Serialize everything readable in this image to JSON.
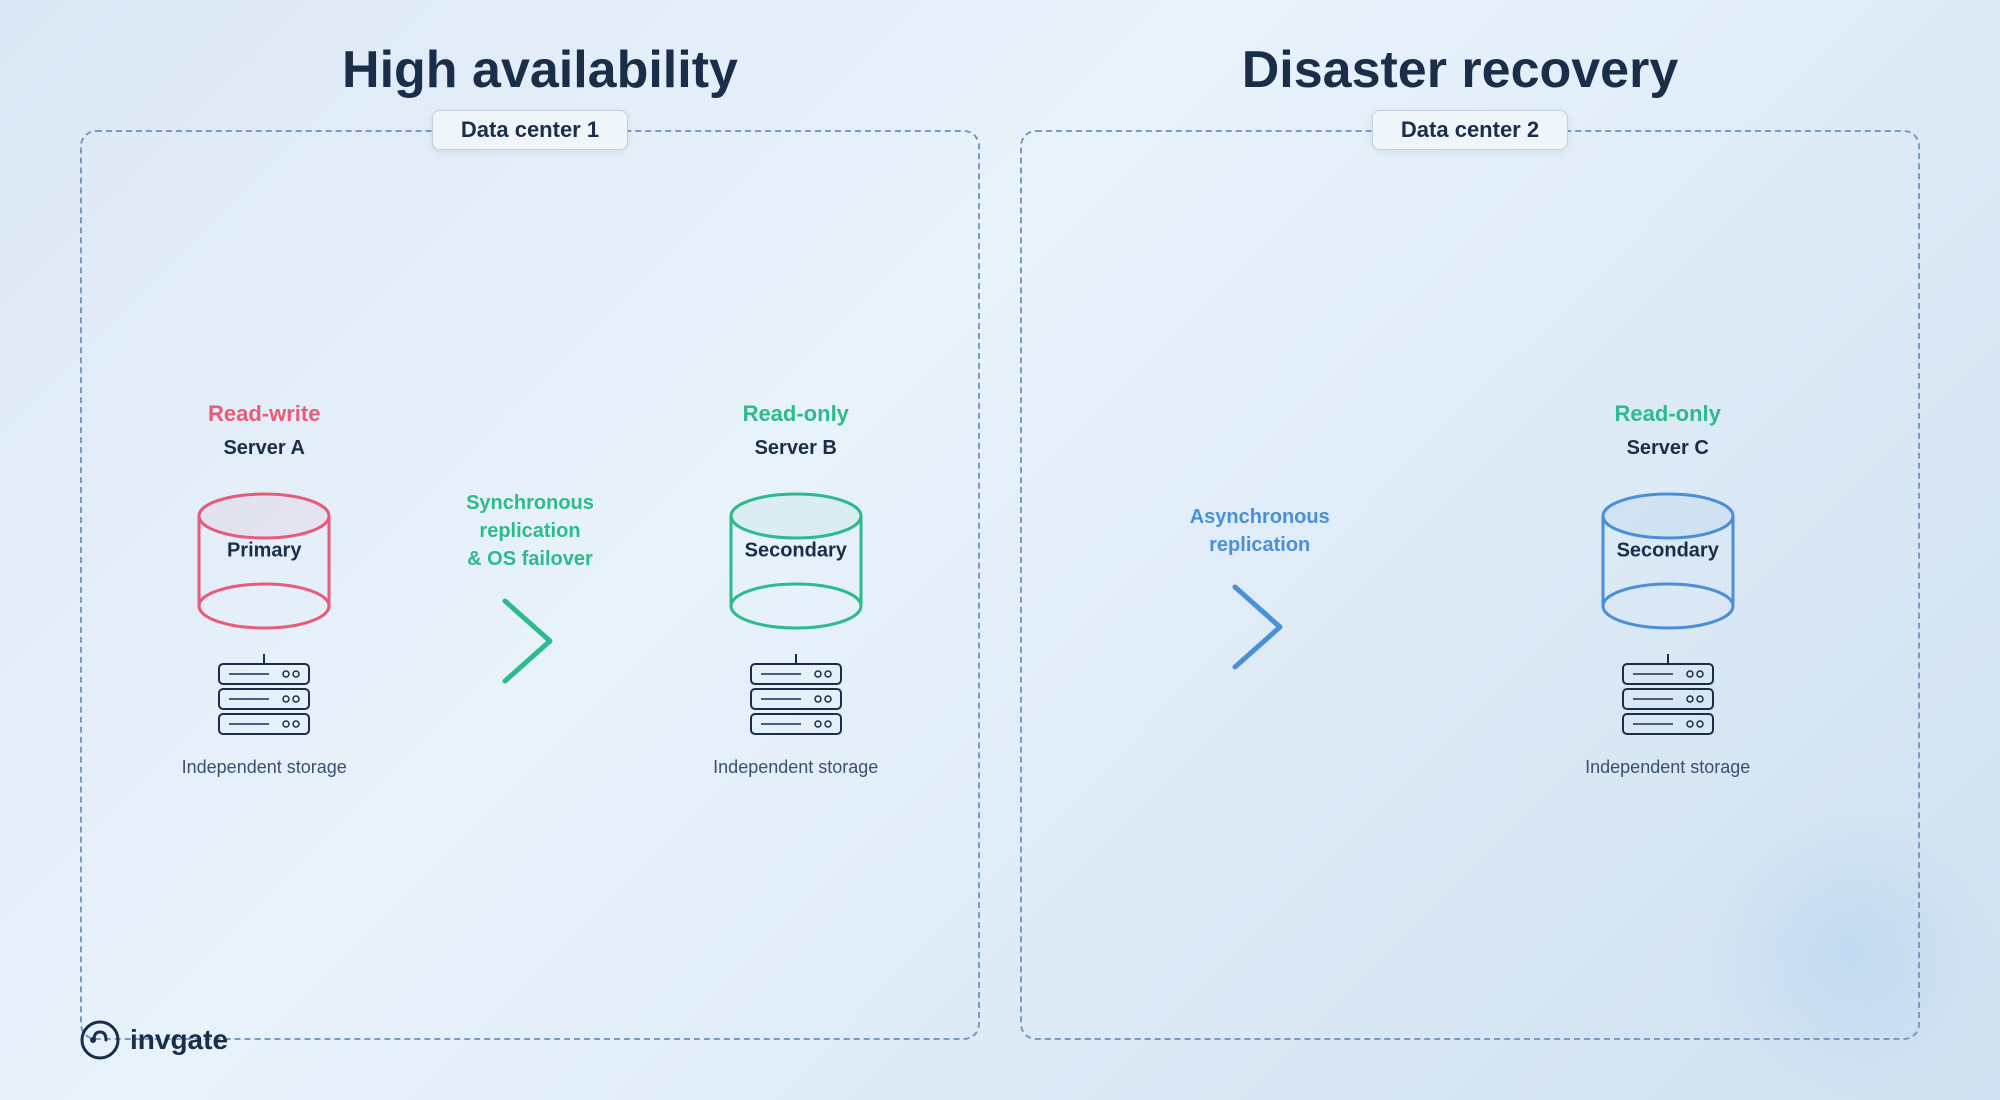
{
  "page": {
    "title_ha": "High availability",
    "title_dr": "Disaster recovery"
  },
  "datacenter1": {
    "label": "Data center 1",
    "serverA": {
      "role": "Read-write",
      "name": "Server A",
      "db_label": "Primary",
      "storage_label": "Independent\nstorage"
    },
    "replication": {
      "label": "Synchronous\nreplication\n& OS failover"
    },
    "serverB": {
      "role": "Read-only",
      "name": "Server B",
      "db_label": "Secondary",
      "storage_label": "Independent\nstorage"
    }
  },
  "datacenter2": {
    "label": "Data center 2",
    "replication": {
      "label": "Asynchronous\nreplication"
    },
    "serverC": {
      "role": "Read-only",
      "name": "Server C",
      "db_label": "Secondary",
      "storage_label": "Independent\nstorage"
    }
  },
  "logo": {
    "text": "invgate"
  },
  "colors": {
    "primary_red": "#e85c7a",
    "green": "#2dba8c",
    "blue": "#4a90d9",
    "dark": "#1a2e4a"
  }
}
